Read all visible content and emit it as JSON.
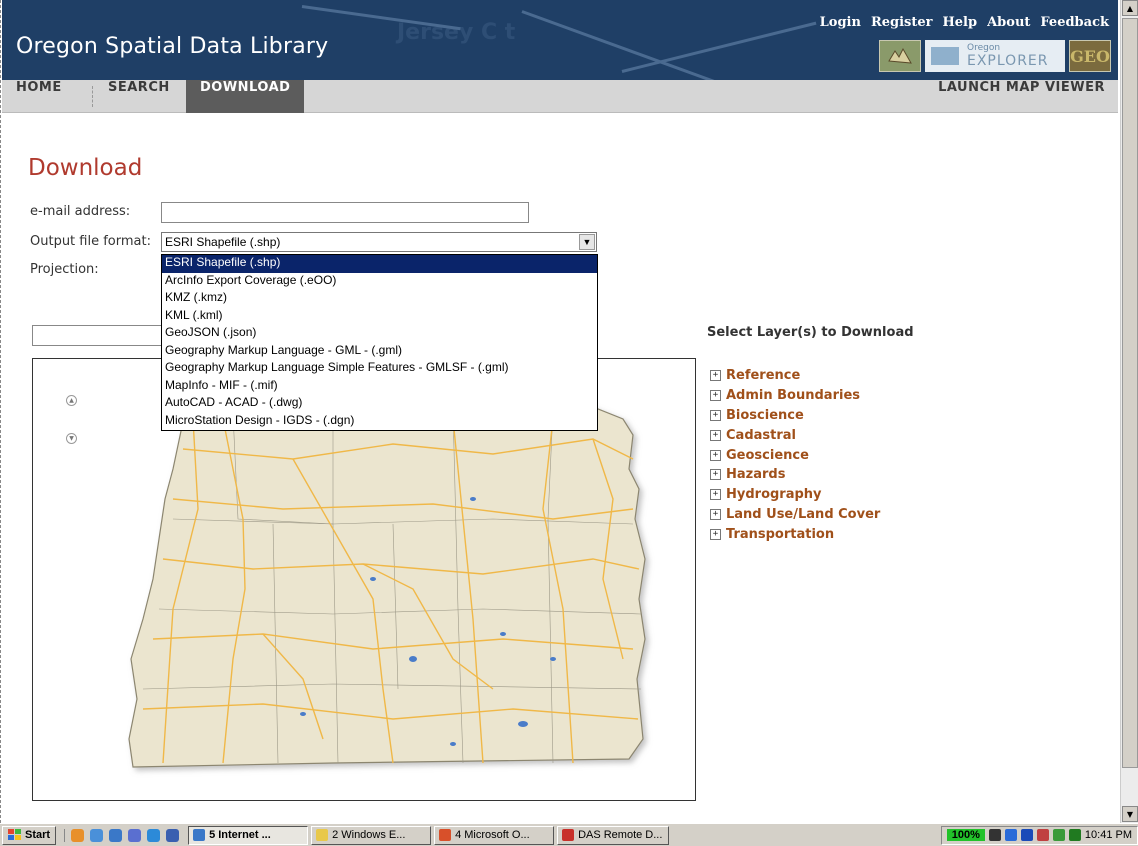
{
  "site": {
    "title": "Oregon Spatial Data Library",
    "background_text": "Jersey C t"
  },
  "top_links": [
    "Login",
    "Register",
    "Help",
    "About",
    "Feedback"
  ],
  "logos": {
    "explorer_small": "Oregon",
    "explorer_big": "EXPLORER",
    "geo": "GEO"
  },
  "nav": {
    "home": "HOME",
    "search": "SEARCH",
    "download": "DOWNLOAD",
    "launch": "LAUNCH MAP VIEWER"
  },
  "page": {
    "title": "Download"
  },
  "form": {
    "email_label": "e-mail address:",
    "email_value": "",
    "format_label": "Output file format:",
    "format_selected": "ESRI Shapefile (.shp)",
    "projection_label": "Projection:",
    "format_options": [
      "ESRI Shapefile (.shp)",
      "ArcInfo Export Coverage (.eOO)",
      "KMZ (.kmz)",
      "KML (.kml)",
      "GeoJSON (.json)",
      "Geography Markup Language - GML - (.gml)",
      "Geography Markup Language Simple Features - GMLSF - (.gml)",
      "MapInfo - MIF - (.mif)",
      "AutoCAD - ACAD - (.dwg)",
      "MicroStation Design - IGDS - (.dgn)"
    ]
  },
  "layers": {
    "title": "Select Layer(s) to Download",
    "items": [
      "Reference",
      "Admin Boundaries",
      "Bioscience",
      "Cadastral",
      "Geoscience",
      "Hazards",
      "Hydrography",
      "Land Use/Land Cover",
      "Transportation"
    ]
  },
  "icons": {
    "zoom_in": "zoom-in-icon",
    "zoom_out": "zoom-out-icon",
    "expand": "plus-box-icon"
  },
  "colors": {
    "header": "#1f3f66",
    "title_red": "#b03a2e",
    "layer_link": "#a0501a",
    "map_land": "#ebe5cf",
    "roads": "#f0b848",
    "selection": "#0a246a"
  },
  "taskbar": {
    "start": "Start",
    "buttons": [
      "5 Internet ...",
      "2 Windows E...",
      "4 Microsoft O...",
      "DAS Remote D..."
    ],
    "battery": "100%",
    "clock": "10:41 PM"
  }
}
